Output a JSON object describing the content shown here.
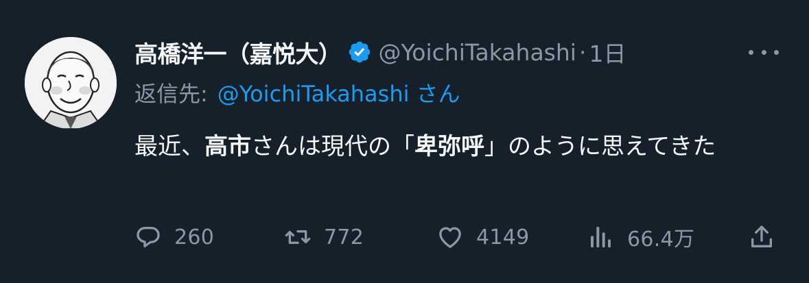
{
  "author": {
    "display_name": "高橋洋一（嘉悦大）",
    "handle": "@YoichiTakahashi",
    "separator": "·",
    "time": "1日"
  },
  "reply": {
    "label": "返信先:",
    "handle": "@YoichiTakahashi さん"
  },
  "tweet": {
    "text_part1": "最近、",
    "text_bold1": "高市",
    "text_part2": "さんは現代の「",
    "text_bold2": "卑弥呼",
    "text_part3": "」のように思えてきた"
  },
  "actions": {
    "replies": "260",
    "retweets": "772",
    "likes": "4149",
    "views": "66.4万"
  },
  "icons": {
    "verified": "verified-badge-icon",
    "more": "more-options-icon",
    "reply": "reply-icon",
    "retweet": "retweet-icon",
    "like": "heart-icon",
    "views": "views-icon",
    "share": "share-icon"
  },
  "colors": {
    "background": "#15202b",
    "primary_text": "#f7f9f9",
    "secondary_text": "#8b98a5",
    "accent": "#1d9bf0"
  }
}
